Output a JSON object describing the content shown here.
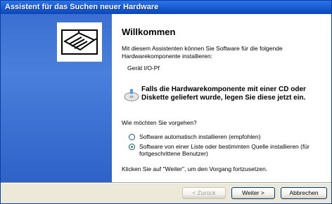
{
  "window": {
    "title": "Assistent für das Suchen neuer Hardware"
  },
  "content": {
    "heading": "Willkommen",
    "intro": "Mit diesem Assistenten können Sie Software für die folgende Hardwarekomponente installieren:",
    "device_name": "Gerät I/O-Pf",
    "warning": "Falls die Hardwarekomponente mit einer CD oder Diskette geliefert wurde, legen Sie diese jetzt ein.",
    "question": "Wie möchten Sie vorgehen?",
    "options": [
      {
        "label": "Software automatisch installieren (empfohlen)",
        "selected": false
      },
      {
        "label": "Software von einer Liste oder bestimmten Quelle installieren (für fortgeschrittene Benutzer)",
        "selected": true
      }
    ],
    "continue_hint": "Klicken Sie auf \"Weiter\", um den Vorgang fortzusetzen."
  },
  "buttons": {
    "back": "< Zurück",
    "next": "Weiter >",
    "cancel": "Abbrechen"
  },
  "colors": {
    "title_bar": "#1b5fd6",
    "wizard_art": "#3b6fd1",
    "dialog_bg": "#ece9d8"
  }
}
